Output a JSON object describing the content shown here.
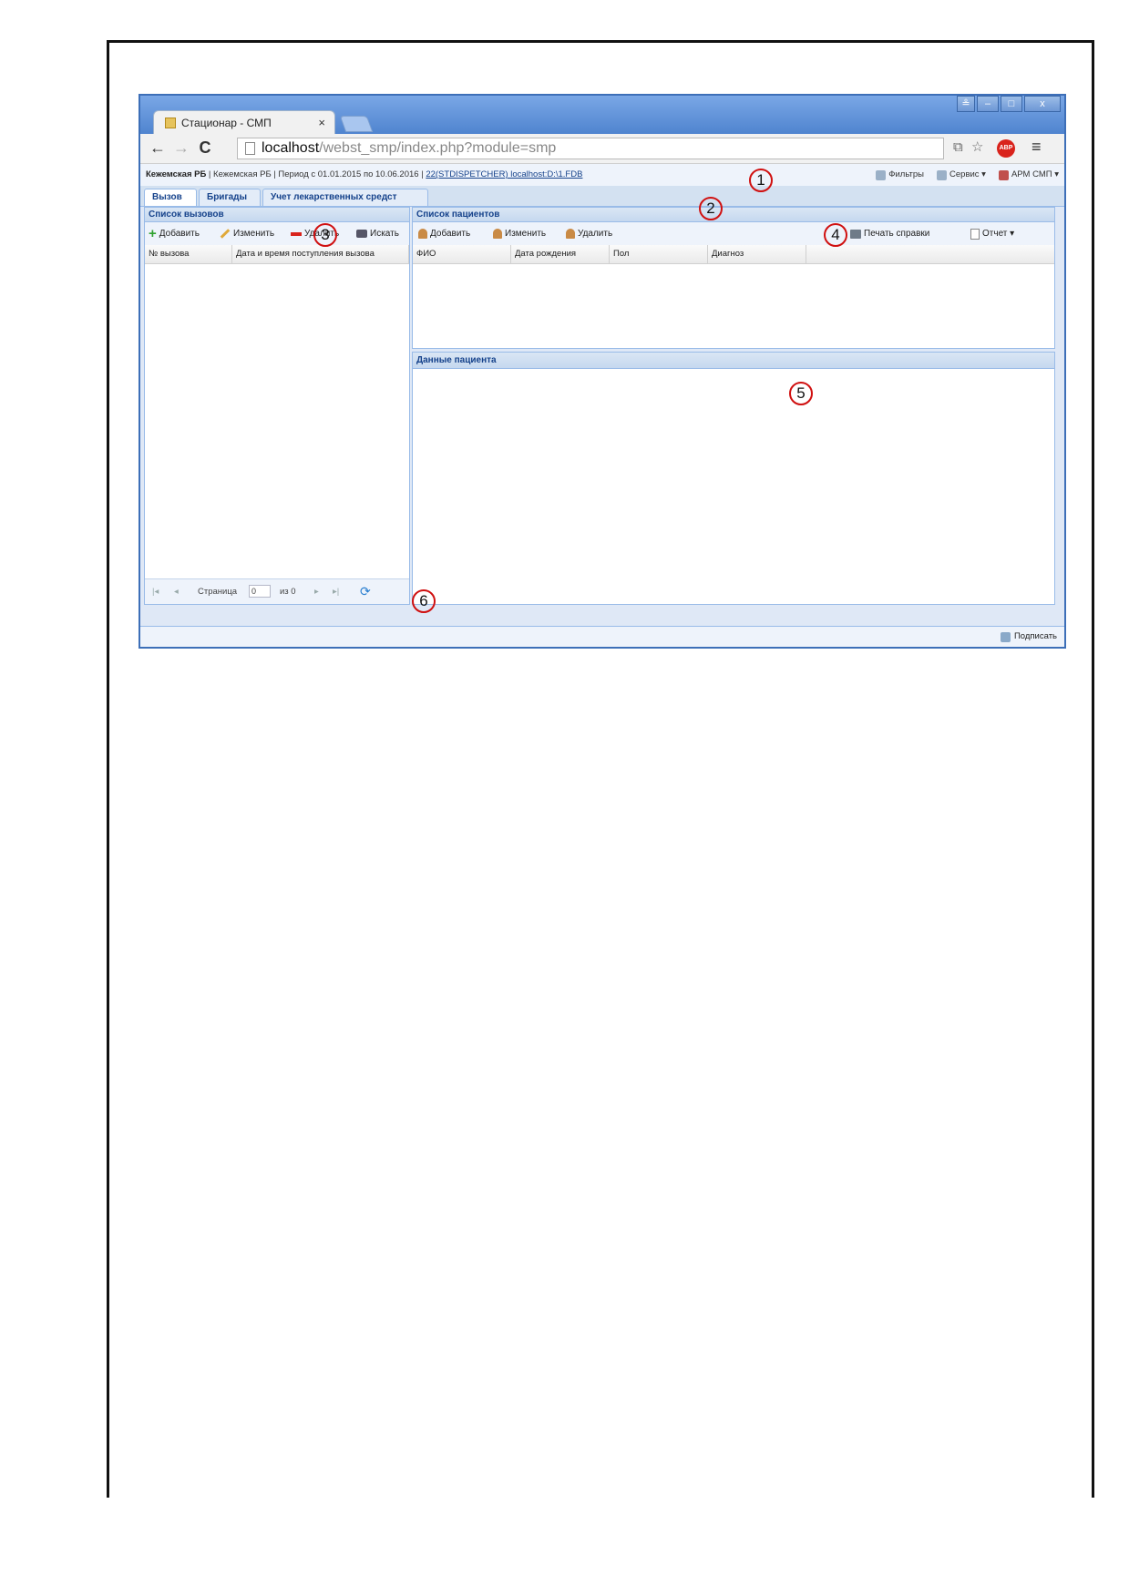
{
  "browser": {
    "tab_title": "Стационар - СМП",
    "tab_close": "×",
    "url_host": "localhost",
    "url_path": "/webst_smp/index.php?module=smp",
    "abp": "ABP",
    "win_buttons": [
      "≗",
      "–",
      "□",
      "x"
    ]
  },
  "header": {
    "org_bold": "Кежемская РБ",
    "info": " | Кежемская РБ | Период с 01.01.2015 по 10.06.2016 | ",
    "link": "22(STDISPETCHER) localhost:D:\\1.FDB",
    "filters": "Фильтры",
    "service": "Сервис ▾",
    "arm": "АРМ СМП ▾"
  },
  "tabs": [
    "Вызов",
    "Бригады",
    "Учет лекарственных средст"
  ],
  "calls": {
    "title": "Список вызовов",
    "add": "Добавить",
    "edit": "Изменить",
    "delete": "Удалить",
    "search": "Искать",
    "columns": [
      "№ вызова",
      "Дата и время поступления вызова"
    ],
    "pager": {
      "page_label": "Страница",
      "page_value": "0",
      "of_label": "из 0"
    }
  },
  "patients": {
    "title": "Список пациентов",
    "add": "Добавить",
    "edit": "Изменить",
    "delete": "Удалить",
    "print": "Печать справки",
    "report": "Отчет ▾",
    "columns": [
      "ФИО",
      "Дата рождения",
      "Пол",
      "Диагноз"
    ]
  },
  "patient_data": {
    "title": "Данные пациента"
  },
  "statusbar": {
    "sign": "Подписать"
  },
  "markers": [
    "1",
    "2",
    "3",
    "4",
    "5",
    "6"
  ]
}
